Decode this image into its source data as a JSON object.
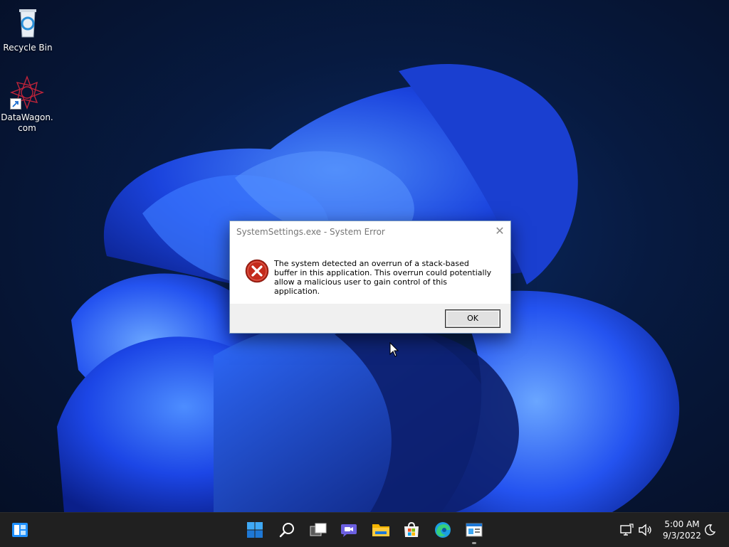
{
  "desktop": {
    "icons": [
      {
        "label": "Recycle Bin",
        "icon": "recycle-bin-icon"
      },
      {
        "label": "DataWagon.com",
        "icon": "datawagon-icon"
      }
    ]
  },
  "dialog": {
    "title": "SystemSettings.exe - System Error",
    "close_glyph": "✕",
    "icon": "error-icon",
    "message": "The system detected an overrun of a stack-based buffer in this application. This overrun could potentially allow a malicious user to gain control of this application.",
    "ok_label": "OK"
  },
  "taskbar": {
    "left_widget": "widgets-icon",
    "center_items": [
      {
        "name": "start-icon"
      },
      {
        "name": "search-icon"
      },
      {
        "name": "task-view-icon"
      },
      {
        "name": "chat-icon"
      },
      {
        "name": "file-explorer-icon"
      },
      {
        "name": "microsoft-store-icon"
      },
      {
        "name": "edge-icon"
      },
      {
        "name": "system-settings-icon"
      }
    ],
    "tray": [
      "network-icon",
      "volume-icon"
    ],
    "time": "5:00 AM",
    "date": "9/3/2022",
    "notification": "do-not-disturb-moon-icon"
  },
  "colors": {
    "taskbar_bg": "#202020",
    "error_red": "#c42b1c",
    "wallpaper_blue": "#1f4fe0"
  }
}
